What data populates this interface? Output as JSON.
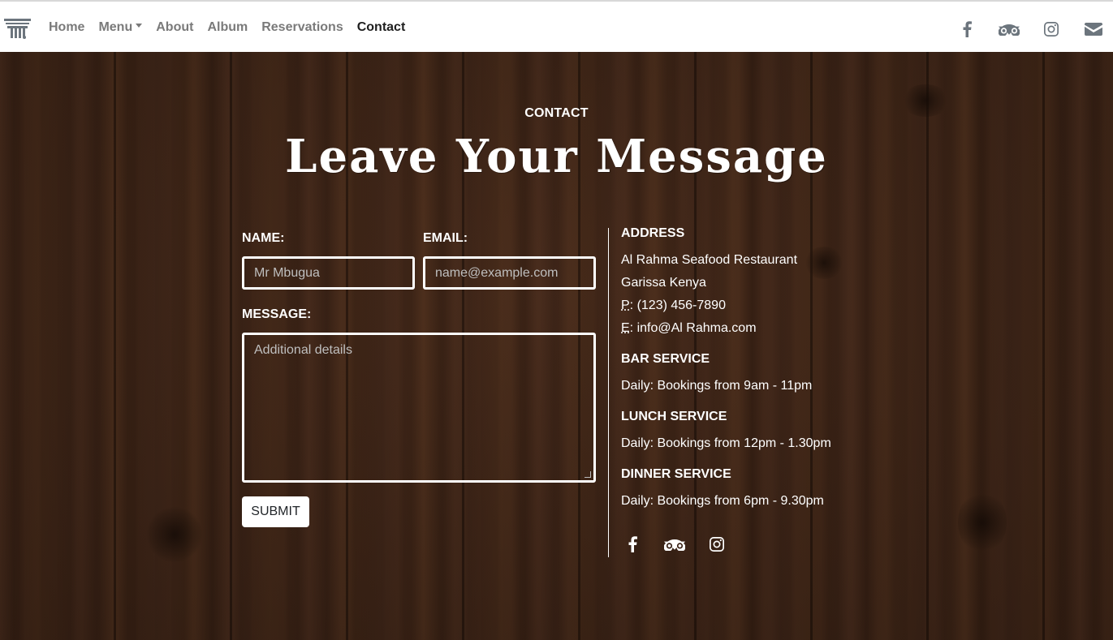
{
  "nav": {
    "brand_icon": "pillar-logo-icon",
    "links": [
      {
        "label": "Home"
      },
      {
        "label": "Menu",
        "dropdown": true
      },
      {
        "label": "About"
      },
      {
        "label": "Album"
      },
      {
        "label": "Reservations"
      },
      {
        "label": "Contact",
        "active": true
      }
    ],
    "icons": [
      "facebook-icon",
      "tripadvisor-icon",
      "instagram-icon",
      "envelope-icon"
    ]
  },
  "hero": {
    "eyebrow": "CONTACT",
    "headline": "Leave Your Message"
  },
  "form": {
    "name_label": "NAME:",
    "name_placeholder": "Mr Mbugua",
    "email_label": "EMAIL:",
    "email_placeholder": "name@example.com",
    "message_label": "MESSAGE:",
    "message_placeholder": "Additional details",
    "submit_label": "SUBMIT"
  },
  "info": {
    "address_heading": "ADDRESS",
    "address_line1": "Al Rahma Seafood Restaurant",
    "address_line2": "Garissa Kenya",
    "phone_prefix": "P",
    "phone": ": (123) 456-7890",
    "email_prefix": "E",
    "email": ": info@Al Rahma.com",
    "bar_heading": "BAR SERVICE",
    "bar_hours": "Daily: Bookings from 9am - 11pm",
    "lunch_heading": "LUNCH SERVICE",
    "lunch_hours": "Daily: Bookings from 12pm - 1.30pm",
    "dinner_heading": "DINNER SERVICE",
    "dinner_hours": "Daily: Bookings from 6pm - 9.30pm",
    "icons": [
      "facebook-icon",
      "tripadvisor-icon",
      "instagram-icon"
    ]
  },
  "colors": {
    "navbar_bg": "#ffffff",
    "nav_text": "#7a7a7a",
    "nav_active": "#1e1e1e",
    "wood_dark": "#3b2418",
    "text_light": "#ffffff"
  }
}
